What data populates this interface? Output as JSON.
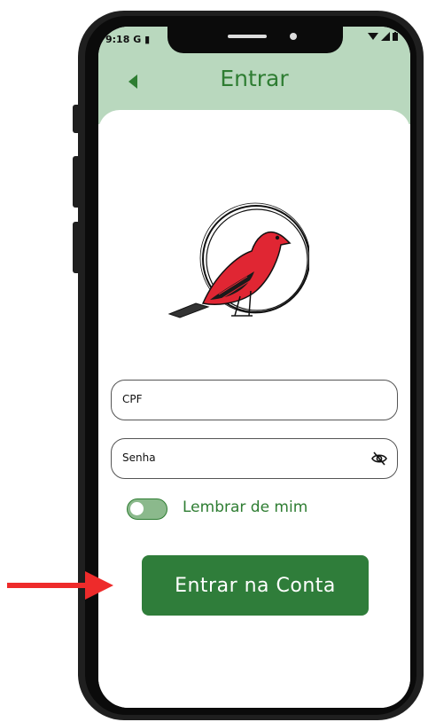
{
  "status_bar": {
    "time": "9:18",
    "carrier_icon": "G",
    "icons": [
      "wifi-icon",
      "signal-icon",
      "battery-icon"
    ]
  },
  "header": {
    "title": "Entrar",
    "back_icon": "back-arrow-icon"
  },
  "logo": {
    "icon": "bird-logo-icon"
  },
  "form": {
    "cpf_label": "CPF",
    "password_label": "Senha",
    "password_icon": "eye-off-icon",
    "remember_label": "Lembrar de mim",
    "remember_checked": false,
    "submit_label": "Entrar na Conta"
  },
  "annotation": {
    "icon": "red-arrow-icon"
  },
  "colors": {
    "primary": "#2f7d3a",
    "header_bg": "#b9d8be",
    "arrow": "#ee2b2b"
  }
}
